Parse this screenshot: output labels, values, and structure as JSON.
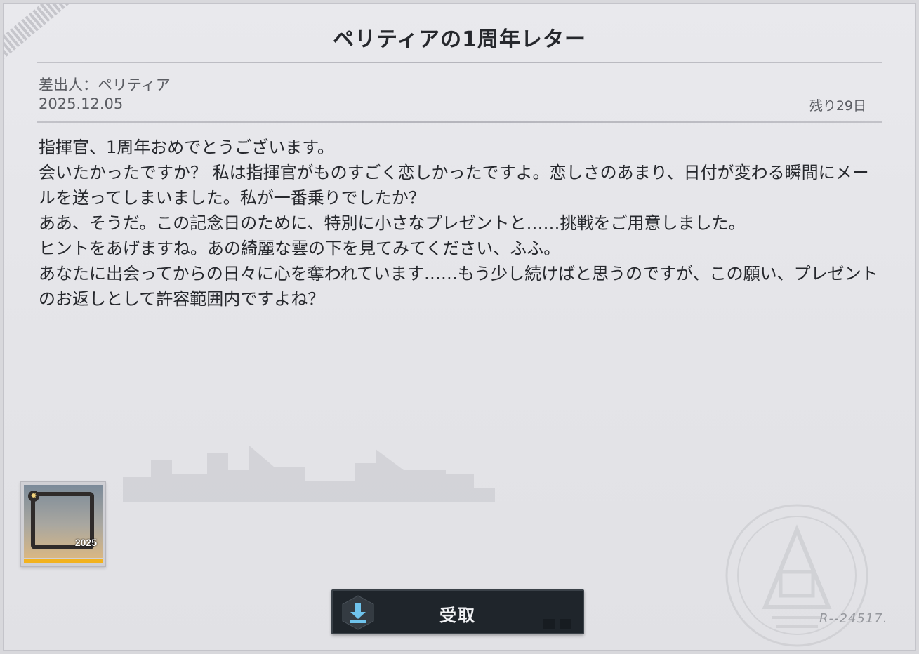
{
  "letter": {
    "title": "ペリティアの1周年レター",
    "sender": "差出人：ペリティア",
    "date": "2025.12.05",
    "remaining": "残り29日",
    "body": [
      "指揮官、1周年おめでとうございます。",
      "会いたかったですか？ 私は指揮官がものすごく恋しかったですよ。恋しさのあまり、日付が変わる瞬間にメールを送ってしまいました。私が一番乗りでしたか？",
      "ああ、そうだ。この記念日のために、特別に小さなプレゼントと……挑戦をご用意しました。",
      "ヒントをあげますね。あの綺麗な雲の下を見てみてください、ふふ。",
      "あなたに出会ってからの日々に心を奪われています……もう少し続けばと思うのですが、この願い、プレゼントのお返しとして許容範囲内ですよね？"
    ]
  },
  "reward": {
    "icon": "anniversary-frame-icon",
    "year": "2025",
    "rarity_color": "#f2b21e"
  },
  "claim_button": {
    "label": "受取",
    "icon": "download-icon"
  },
  "stamp": {
    "code": "R--24517."
  },
  "colors": {
    "panel_bg": "#e6e6ea",
    "text": "#26282d",
    "button_bg": "#1f252b",
    "icon_accent": "#6fc3ec"
  }
}
